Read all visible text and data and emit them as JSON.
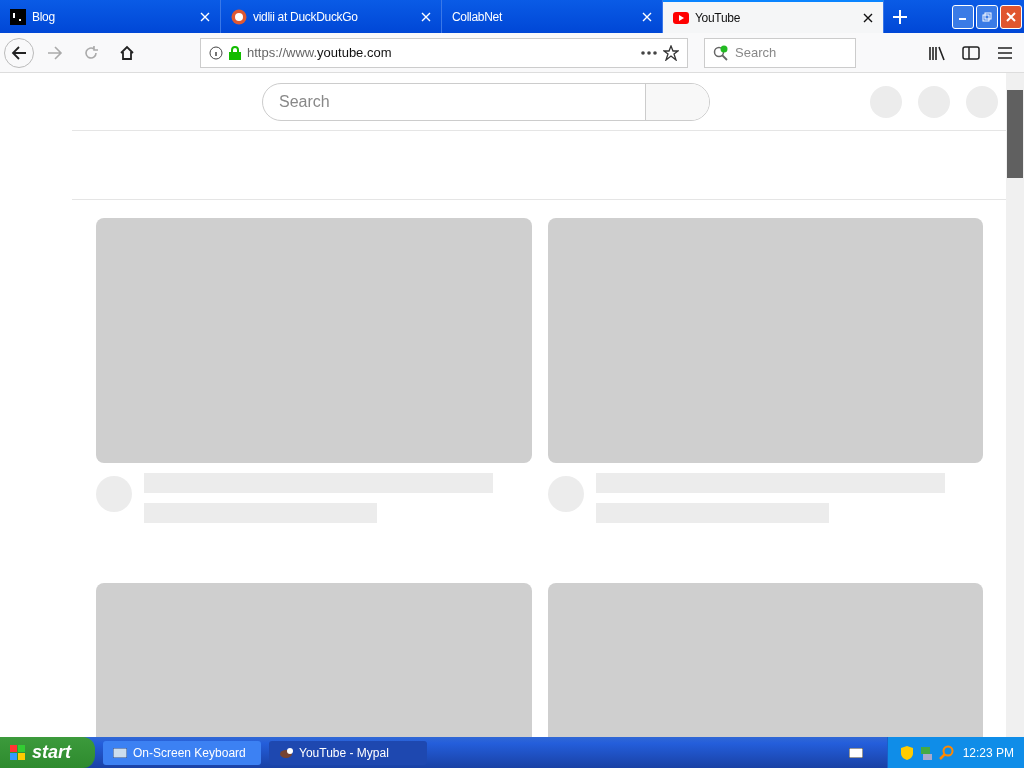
{
  "tabs": [
    {
      "title": "Blog",
      "selected": false
    },
    {
      "title": "vidlii at DuckDuckGo",
      "selected": false
    },
    {
      "title": "CollabNet",
      "selected": false
    },
    {
      "title": "YouTube",
      "selected": true
    }
  ],
  "address_bar": {
    "url_prefix": "https://www.",
    "url_domain": "youtube.com"
  },
  "browser_search": {
    "placeholder": "Search"
  },
  "page": {
    "search": {
      "placeholder": "Search"
    },
    "video_placeholders": [
      {
        "kind": "skeleton"
      },
      {
        "kind": "skeleton"
      },
      {
        "kind": "thumbnail"
      },
      {
        "kind": "thumbnail"
      }
    ]
  },
  "taskbar": {
    "start": "start",
    "items": [
      {
        "label": "On-Screen Keyboard",
        "selected": false
      },
      {
        "label": "YouTube - Mypal",
        "selected": true
      }
    ],
    "clock": "12:23 PM"
  }
}
